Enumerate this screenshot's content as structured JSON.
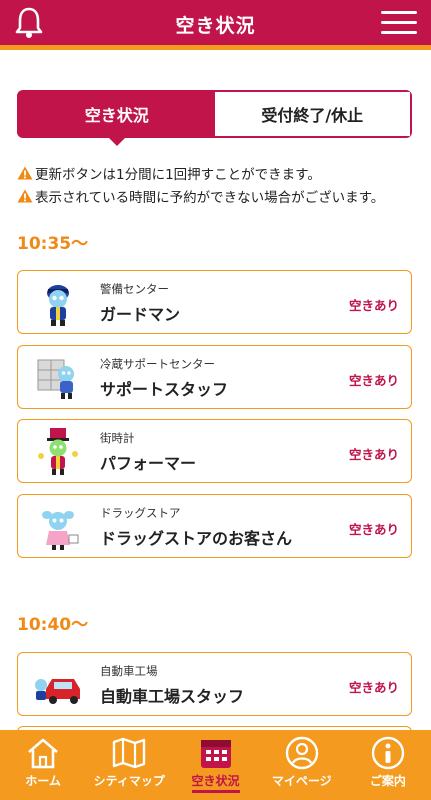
{
  "header": {
    "title": "空き状況"
  },
  "tabs": [
    {
      "label": "空き状況",
      "active": true
    },
    {
      "label": "受付終了/休止",
      "active": false
    }
  ],
  "notes": [
    "更新ボタンは1分間に1回押すことができます。",
    "表示されている時間に予約ができない場合がございます。"
  ],
  "slots": [
    {
      "time": "10:35〜",
      "items": [
        {
          "category": "警備センター",
          "job": "ガードマン",
          "status": "空きあり",
          "icon": "guardman-character-icon"
        },
        {
          "category": "冷蔵サポートセンター",
          "job": "サポートスタッフ",
          "status": "空きあり",
          "icon": "support-staff-character-icon"
        },
        {
          "category": "街時計",
          "job": "パフォーマー",
          "status": "空きあり",
          "icon": "performer-character-icon"
        },
        {
          "category": "ドラッグストア",
          "job": "ドラッグストアのお客さん",
          "status": "空きあり",
          "icon": "drugstore-customer-character-icon"
        }
      ]
    },
    {
      "time": "10:40〜",
      "items": [
        {
          "category": "自動車工場",
          "job": "自動車工場スタッフ",
          "status": "空きあり",
          "icon": "car-factory-character-icon"
        }
      ]
    }
  ],
  "bottom_nav": [
    {
      "label": "ホーム",
      "icon": "home-icon"
    },
    {
      "label": "シティマップ",
      "icon": "map-icon"
    },
    {
      "label": "空き状況",
      "icon": "calendar-icon",
      "active": true
    },
    {
      "label": "マイページ",
      "icon": "user-icon"
    },
    {
      "label": "ご案内",
      "icon": "info-person-icon"
    }
  ],
  "colors": {
    "primary": "#c0144a",
    "accent": "#f39a1f",
    "time": "#f08a16"
  }
}
